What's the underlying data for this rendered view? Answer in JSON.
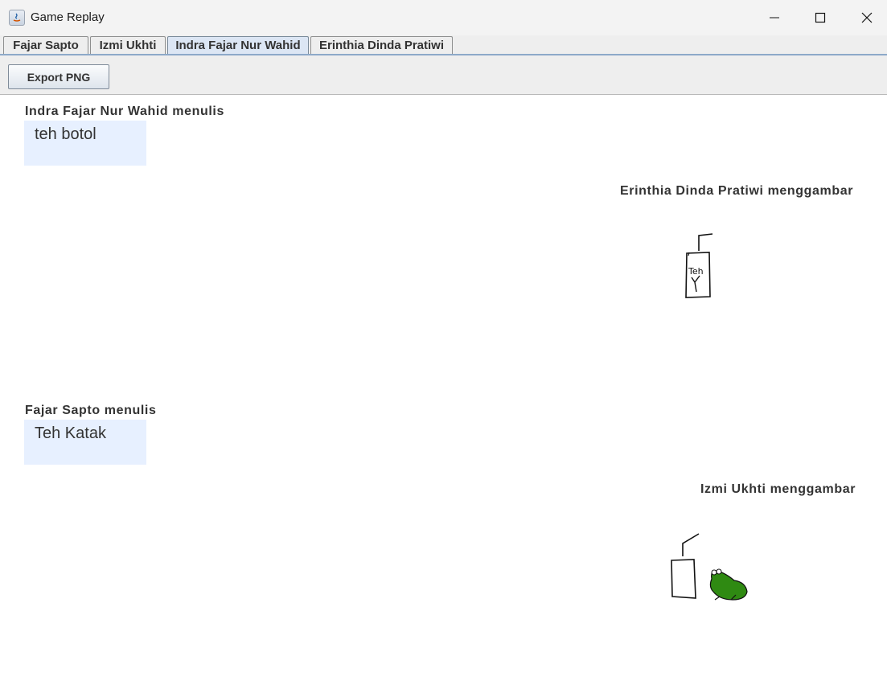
{
  "window": {
    "title": "Game Replay"
  },
  "tabs": [
    {
      "label": "Fajar Sapto",
      "active": false
    },
    {
      "label": "Izmi Ukhti",
      "active": false
    },
    {
      "label": "Indra Fajar Nur Wahid",
      "active": true
    },
    {
      "label": "Erinthia Dinda Pratiwi",
      "active": false
    }
  ],
  "toolbar": {
    "export_label": "Export PNG"
  },
  "replay": [
    {
      "type": "write",
      "label": "Indra Fajar Nur Wahid menulis",
      "text": "teh botol"
    },
    {
      "type": "draw",
      "label": "Erinthia Dinda Pratiwi menggambar",
      "drawing": "teh-bottle-sketch",
      "drawing_text": "Teh"
    },
    {
      "type": "write",
      "label": "Fajar Sapto menulis",
      "text": "Teh Katak"
    },
    {
      "type": "draw",
      "label": "Izmi Ukhti menggambar",
      "drawing": "carton-and-frog-sketch"
    }
  ],
  "colors": {
    "bubble": "#e7f0ff",
    "active_tab": "#dce6f4",
    "frog": "#2f8a12"
  }
}
